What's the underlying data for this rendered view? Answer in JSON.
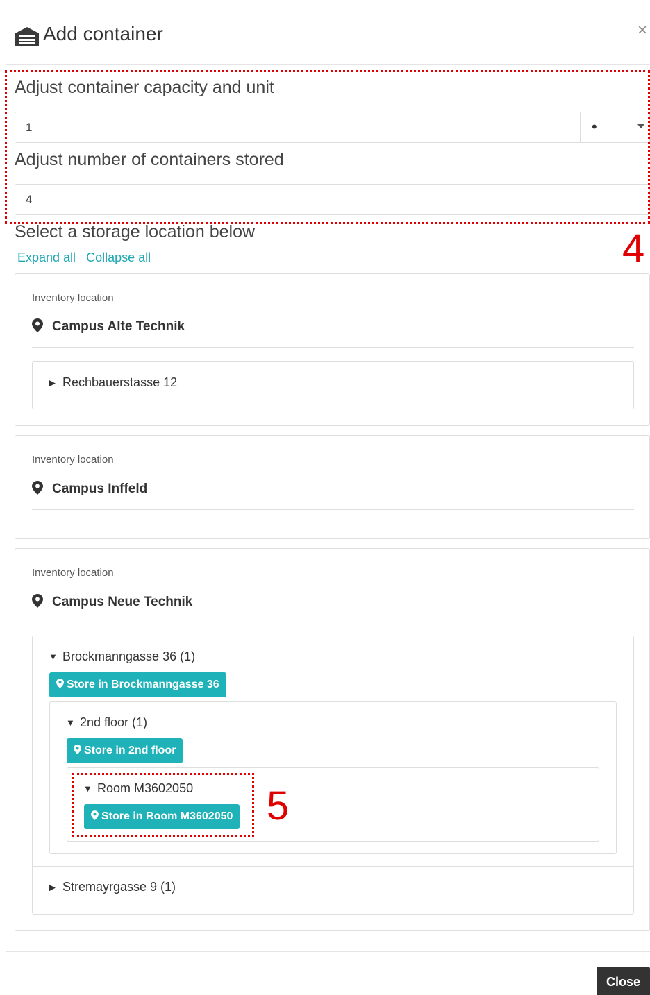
{
  "dialog": {
    "title": "Add container",
    "title_icon": "warehouse-icon",
    "close_icon_glyph": "×"
  },
  "capacity": {
    "label": "Adjust container capacity and unit",
    "value": "1",
    "unit_value": "•"
  },
  "count": {
    "label": "Adjust number of containers stored",
    "value": "4"
  },
  "storage": {
    "label": "Select a storage location below",
    "expand_all": "Expand all",
    "collapse_all": "Collapse all"
  },
  "locations": [
    {
      "type_label": "Inventory location",
      "name": "Campus Alte Technik",
      "children": [
        {
          "label": "Rechbauerstasse 12",
          "expanded": false
        }
      ]
    },
    {
      "type_label": "Inventory location",
      "name": "Campus Inffeld",
      "children": []
    },
    {
      "type_label": "Inventory location",
      "name": "Campus Neue Technik",
      "children": [
        {
          "label": "Brockmanngasse 36 (1)",
          "expanded": true,
          "store_label": "Store in Brockmanngasse 36",
          "children": [
            {
              "label": "2nd floor (1)",
              "expanded": true,
              "store_label": "Store in 2nd floor",
              "children": [
                {
                  "label": "Room M3602050",
                  "expanded": true,
                  "store_label": "Store in Room M3602050"
                }
              ]
            }
          ]
        },
        {
          "label": "Stremayrgasse 9 (1)",
          "expanded": false
        }
      ]
    }
  ],
  "annotations": [
    "4",
    "5"
  ],
  "footer": {
    "close_label": "Close"
  },
  "colors": {
    "accent": "#1fb2b8",
    "link": "#1fa8b4",
    "annotation": "#e00000",
    "close_button": "#333333"
  }
}
